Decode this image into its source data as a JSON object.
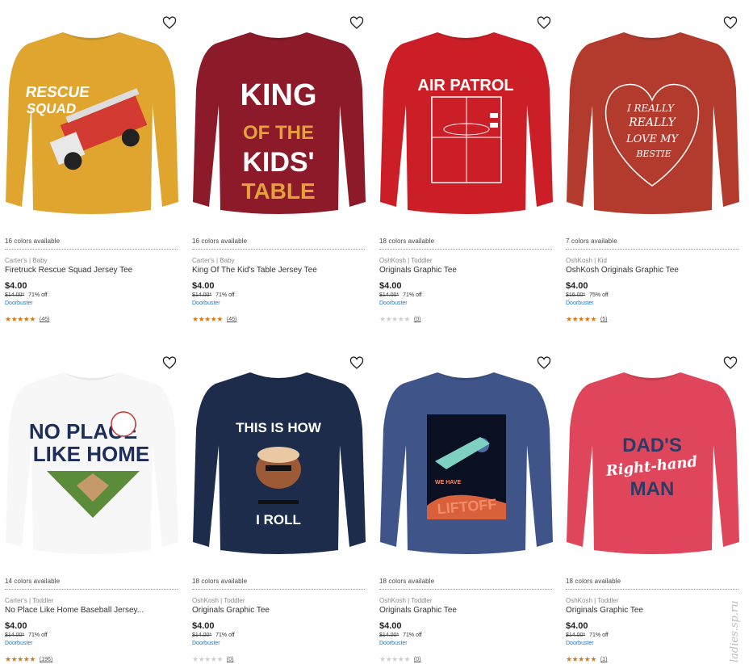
{
  "products": [
    {
      "colors_available": "16 colors available",
      "brand": "Carter's | Baby",
      "name": "Firetruck Rescue Squad Jersey Tee",
      "price": "$4.00",
      "was_price": "$14.00*",
      "discount": "71% off",
      "promo": "Doorbuster",
      "rating_stars": 5,
      "review_count": "(46)",
      "shirt_color": "#e0a52e",
      "graphic_text": [
        "RESCUE",
        "SQUAD"
      ]
    },
    {
      "colors_available": "16 colors available",
      "brand": "Carter's | Baby",
      "name": "King Of The Kid's Table Jersey Tee",
      "price": "$4.00",
      "was_price": "$14.00*",
      "discount": "71% off",
      "promo": "Doorbuster",
      "rating_stars": 5,
      "review_count": "(46)",
      "shirt_color": "#8d1a28",
      "graphic_text": [
        "KING",
        "OF THE",
        "KIDS'",
        "TABLE"
      ]
    },
    {
      "colors_available": "18 colors available",
      "brand": "OshKosh | Toddler",
      "name": "Originals Graphic Tee",
      "price": "$4.00",
      "was_price": "$14.00*",
      "discount": "71% off",
      "promo": "Doorbuster",
      "rating_stars": 0,
      "review_count": "(0)",
      "shirt_color": "#cc1e26",
      "graphic_text": [
        "AIR PATROL"
      ]
    },
    {
      "colors_available": "7 colors available",
      "brand": "OshKosh | Kid",
      "name": "OshKosh Originals Graphic Tee",
      "price": "$4.00",
      "was_price": "$16.00*",
      "discount": "75% off",
      "promo": "Doorbuster",
      "rating_stars": 5,
      "review_count": "(5)",
      "shirt_color": "#b23b2e",
      "graphic_text": [
        "I REALLY",
        "REALLY",
        "LOVE MY",
        "BESTIE"
      ]
    },
    {
      "colors_available": "14 colors available",
      "brand": "Carter's | Toddler",
      "name": "No Place Like Home Baseball Jersey...",
      "price": "$4.00",
      "was_price": "$14.00*",
      "discount": "71% off",
      "promo": "Doorbuster",
      "rating_stars": 5,
      "review_count": "(196)",
      "shirt_color": "#f7f7f7",
      "graphic_text": [
        "NO PLACE",
        "LIKE HOME"
      ]
    },
    {
      "colors_available": "18 colors available",
      "brand": "OshKosh | Toddler",
      "name": "Originals Graphic Tee",
      "price": "$4.00",
      "was_price": "$14.00*",
      "discount": "71% off",
      "promo": "Doorbuster",
      "rating_stars": 0,
      "review_count": "(0)",
      "shirt_color": "#1c2c4a",
      "graphic_text": [
        "THIS IS HOW",
        "I ROLL"
      ]
    },
    {
      "colors_available": "18 colors available",
      "brand": "OshKosh | Toddler",
      "name": "Originals Graphic Tee",
      "price": "$4.00",
      "was_price": "$14.00*",
      "discount": "71% off",
      "promo": "Doorbuster",
      "rating_stars": 0,
      "review_count": "(0)",
      "shirt_color": "#3f5488",
      "graphic_text": [
        "WE HAVE",
        "LIFTOFF"
      ]
    },
    {
      "colors_available": "18 colors available",
      "brand": "OshKosh | Toddler",
      "name": "Originals Graphic Tee",
      "price": "$4.00",
      "was_price": "$14.00*",
      "discount": "71% off",
      "promo": "Doorbuster",
      "rating_stars": 5,
      "review_count": "(1)",
      "shirt_color": "#e0465b",
      "graphic_text": [
        "DAD'S",
        "Right-hand",
        "MAN"
      ]
    }
  ],
  "icons": {
    "favorite": "heart-outline-icon",
    "star": "star-icon"
  },
  "colors": {
    "star_on": "#d27a1e",
    "star_off": "#d0d0d0",
    "promo": "#1a73c9"
  },
  "watermark": "ladies.sp.ru"
}
